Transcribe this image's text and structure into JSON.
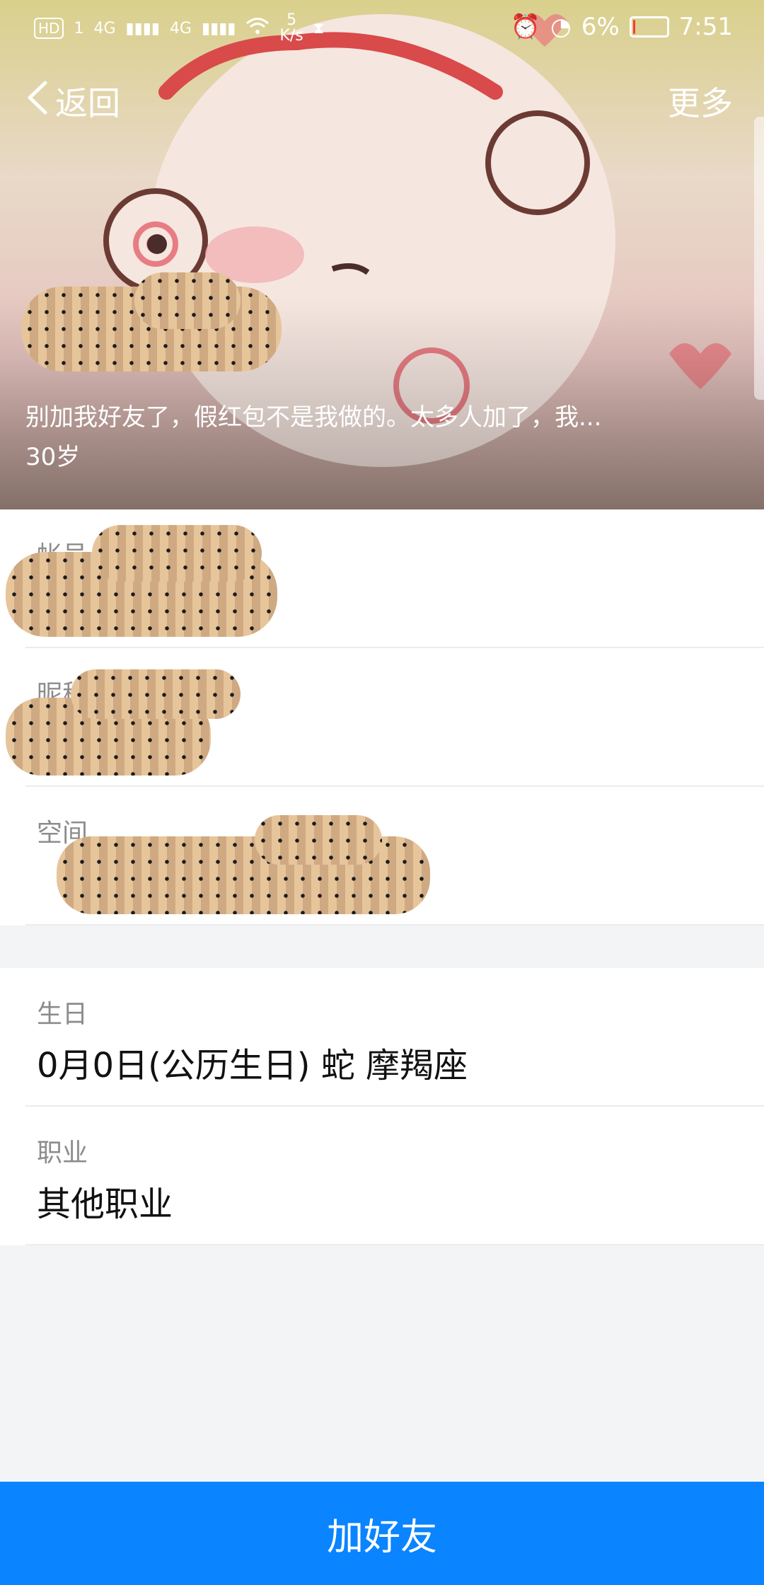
{
  "status_bar": {
    "badge_hd": "HD",
    "badge_sim": "1",
    "signal1_label": "4G",
    "signal2_label": "4G",
    "net_speed_value": "5",
    "net_speed_unit": "K/s",
    "battery_percent": "6%",
    "battery_level": 0.06,
    "time": "7:51",
    "icons": [
      "wifi-icon",
      "hourglass-icon",
      "alarm-icon",
      "speed-icon",
      "battery-icon"
    ]
  },
  "nav": {
    "back_label": "返回",
    "more_label": "更多"
  },
  "profile": {
    "signature": "别加我好友了，假红包不是我做的。太多人加了，我...",
    "age": "30岁"
  },
  "info_rows": [
    {
      "label": "帐号",
      "value": ""
    },
    {
      "label": "昵称",
      "value": ""
    },
    {
      "label": "空间",
      "value": ""
    }
  ],
  "detail_rows": [
    {
      "label": "生日",
      "value": "0月0日(公历生日) 蛇 摩羯座"
    },
    {
      "label": "职业",
      "value": "其他职业"
    }
  ],
  "footer": {
    "add_friend_label": "加好友"
  },
  "colors": {
    "accent": "#0a84ff",
    "battery_low": "#ff3b30"
  }
}
